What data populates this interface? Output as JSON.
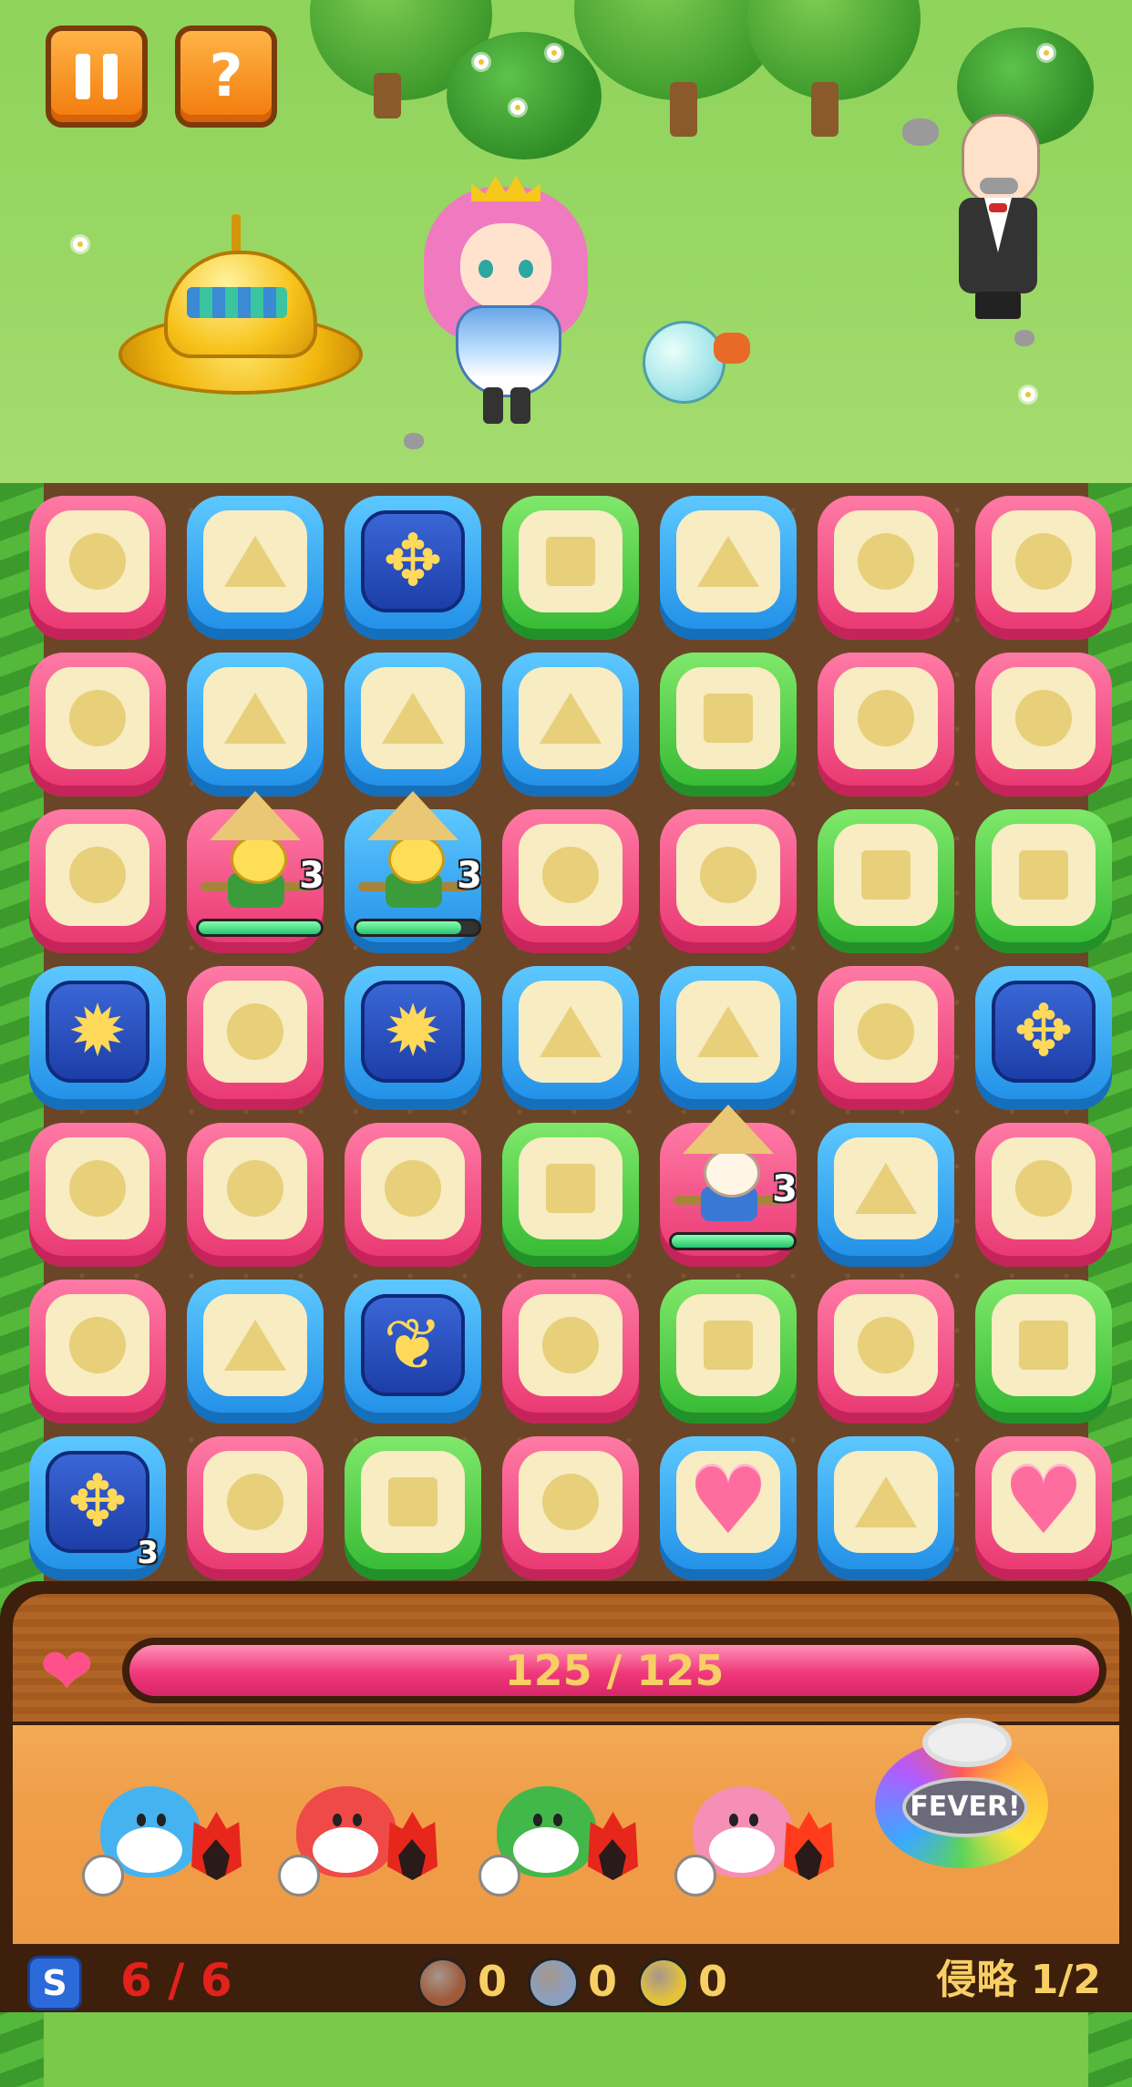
{
  "hud": {
    "pause_button": "pause-icon",
    "help_button": "?"
  },
  "scene": {
    "characters": [
      "princess",
      "butler",
      "ufo",
      "bubble-creature"
    ]
  },
  "board": {
    "rows": [
      [
        "pink-circle",
        "blue-triangle",
        "special-cross",
        "green-square",
        "blue-triangle",
        "pink-circle",
        "pink-circle"
      ],
      [
        "pink-circle",
        "blue-triangle",
        "blue-triangle",
        "blue-triangle",
        "green-square",
        "pink-circle",
        "pink-circle"
      ],
      [
        "pink-circle",
        "scarecrow",
        "scarecrow",
        "pink-circle",
        "pink-circle",
        "green-square",
        "green-square"
      ],
      [
        "special-sun",
        "pink-circle",
        "special-sun",
        "blue-triangle",
        "blue-triangle",
        "pink-circle",
        "special-cross"
      ],
      [
        "pink-circle",
        "pink-circle",
        "pink-circle",
        "green-square",
        "scarecrow",
        "blue-triangle",
        "pink-circle"
      ],
      [
        "pink-circle",
        "blue-triangle",
        "special-wings",
        "pink-circle",
        "green-square",
        "pink-circle",
        "green-square"
      ],
      [
        "special-cross",
        "pink-circle",
        "green-square",
        "pink-circle",
        "heart",
        "blue-triangle",
        "heart"
      ]
    ],
    "scarecrow_counter": "3",
    "special_counter": "3"
  },
  "player": {
    "hp_text": "125 / 125",
    "hp_fraction": 1.0
  },
  "monsters": [
    {
      "name": "blue",
      "color": "#45b3f0"
    },
    {
      "name": "red",
      "color": "#ef4a47"
    },
    {
      "name": "green",
      "color": "#43b84a"
    },
    {
      "name": "pink",
      "color": "#f58fb5"
    }
  ],
  "fever": {
    "label": "FEVER!"
  },
  "footer": {
    "s_label": "S",
    "moves": "6 / 6",
    "resources": [
      {
        "name": "brown",
        "value": "0",
        "color": "#a05a3a"
      },
      {
        "name": "silver",
        "value": "0",
        "color": "#8aa0c0"
      },
      {
        "name": "gold",
        "value": "0",
        "color": "#e4c23a"
      }
    ],
    "stage": "侵略 1/2"
  }
}
